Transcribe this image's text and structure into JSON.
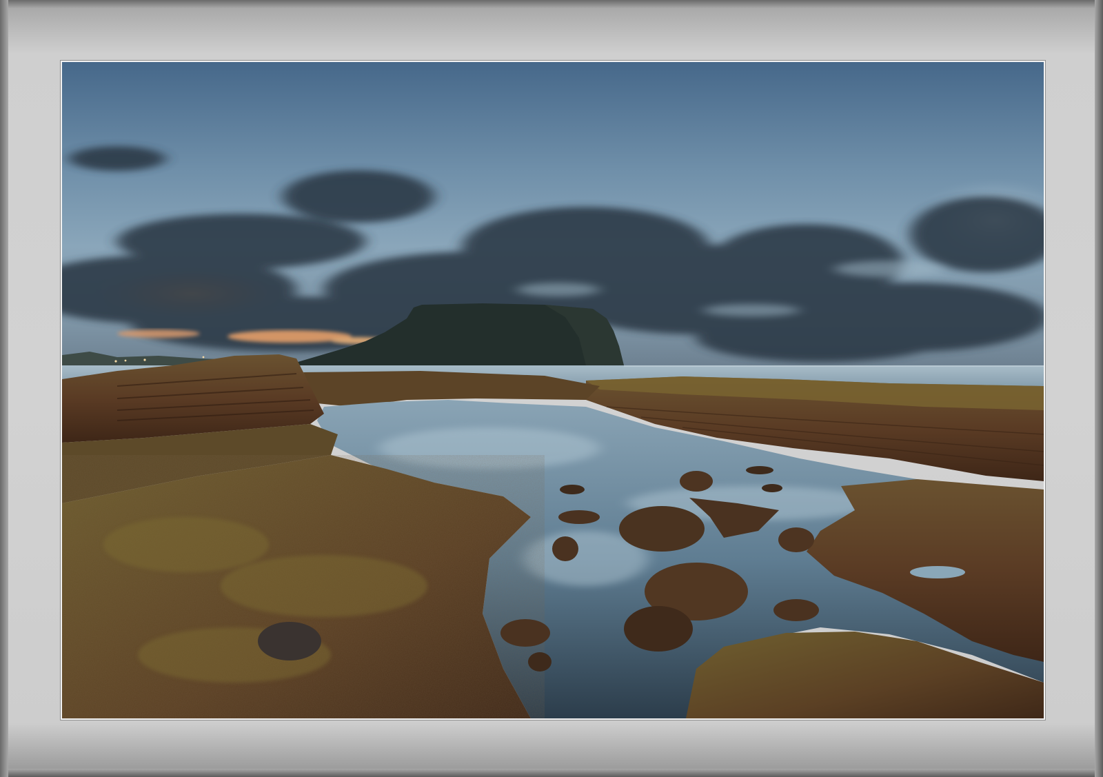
{
  "scene": {
    "subject": "coastal-landscape-photo",
    "colors": {
      "frame": "#c9c9c9",
      "sky_top": "#4d6f8e",
      "sky_mid": "#7f9db2",
      "cloud": "#2f3c49",
      "sunset_glow": "#f1a468",
      "headland": "#23302d",
      "sea": "#8ea7b6",
      "rock": "#5a3a24",
      "moss": "#6b5a2e",
      "water_reflection": "#9fb8c8"
    }
  }
}
